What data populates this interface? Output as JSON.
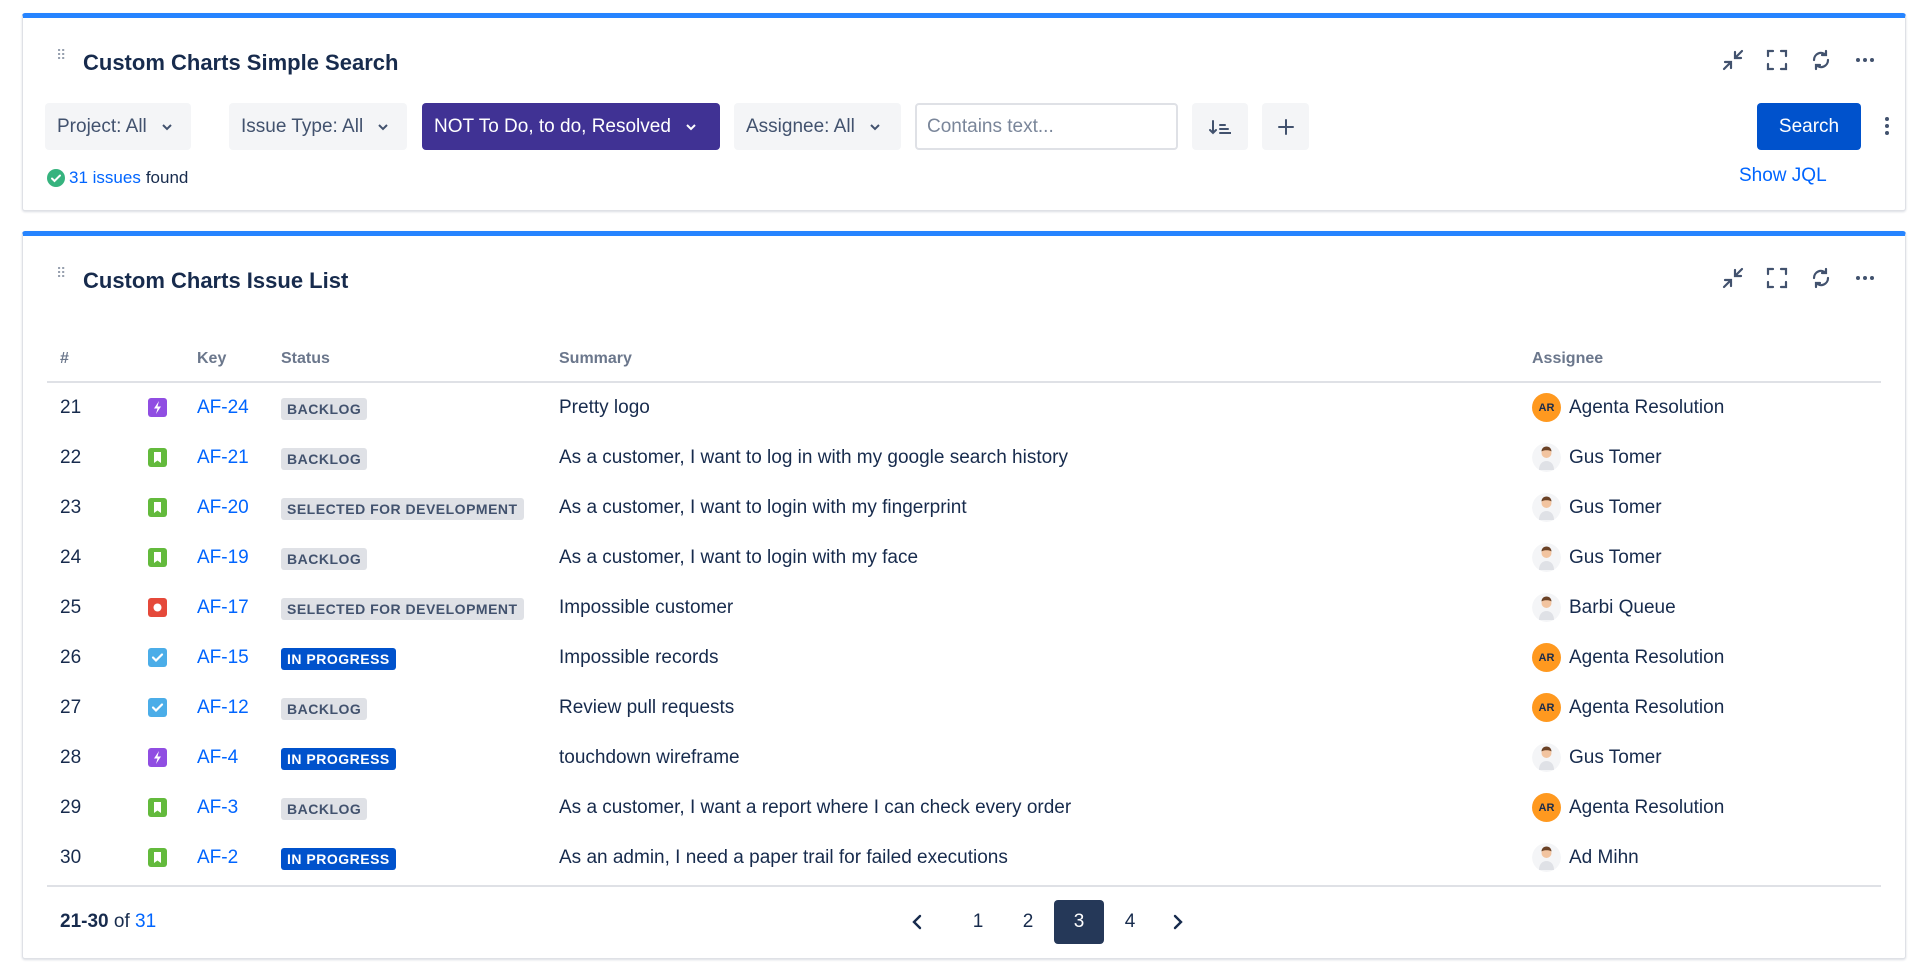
{
  "search_gadget": {
    "title": "Custom Charts Simple Search",
    "filters": {
      "project": "Project: All",
      "issue_type": "Issue Type: All",
      "status": "NOT To Do, to do, Resolved",
      "assignee": "Assignee: All"
    },
    "text_placeholder": "Contains text...",
    "search_label": "Search",
    "result_count": "31 issues",
    "result_suffix": "found",
    "show_jql": "Show JQL"
  },
  "list_gadget": {
    "title": "Custom Charts Issue List",
    "columns": {
      "num": "#",
      "key": "Key",
      "status": "Status",
      "summary": "Summary",
      "assignee": "Assignee"
    },
    "rows": [
      {
        "num": "21",
        "type": "epic-icon",
        "key": "AF-24",
        "status": "BACKLOG",
        "summary": "Pretty logo",
        "assignee": "Agenta Resolution",
        "avatar": "AR"
      },
      {
        "num": "22",
        "type": "story-icon",
        "key": "AF-21",
        "status": "BACKLOG",
        "summary": "As a customer, I want to log in with my google search history",
        "assignee": "Gus Tomer",
        "avatar": "person-avatar"
      },
      {
        "num": "23",
        "type": "story-icon",
        "key": "AF-20",
        "status": "SELECTED FOR DEVELOPMENT",
        "summary": "As a customer, I want to login with my fingerprint",
        "assignee": "Gus Tomer",
        "avatar": "person-avatar"
      },
      {
        "num": "24",
        "type": "story-icon",
        "key": "AF-19",
        "status": "BACKLOG",
        "summary": "As a customer, I want to login with my face",
        "assignee": "Gus Tomer",
        "avatar": "person-avatar"
      },
      {
        "num": "25",
        "type": "bug-icon",
        "key": "AF-17",
        "status": "SELECTED FOR DEVELOPMENT",
        "summary": "Impossible customer",
        "assignee": "Barbi Queue",
        "avatar": "person-avatar"
      },
      {
        "num": "26",
        "type": "task-icon",
        "key": "AF-15",
        "status": "IN PROGRESS",
        "summary": "Impossible records",
        "assignee": "Agenta Resolution",
        "avatar": "AR"
      },
      {
        "num": "27",
        "type": "task-icon",
        "key": "AF-12",
        "status": "BACKLOG",
        "summary": "Review pull requests",
        "assignee": "Agenta Resolution",
        "avatar": "AR"
      },
      {
        "num": "28",
        "type": "epic-icon",
        "key": "AF-4",
        "status": "IN PROGRESS",
        "summary": "touchdown wireframe",
        "assignee": "Gus Tomer",
        "avatar": "person-avatar"
      },
      {
        "num": "29",
        "type": "story-icon",
        "key": "AF-3",
        "status": "BACKLOG",
        "summary": "As a customer, I want a report where I can check every order",
        "assignee": "Agenta Resolution",
        "avatar": "AR"
      },
      {
        "num": "30",
        "type": "story-icon",
        "key": "AF-2",
        "status": "IN PROGRESS",
        "summary": "As an admin, I need a paper trail for failed executions",
        "assignee": "Ad Mihn",
        "avatar": "person-avatar"
      }
    ],
    "footer": {
      "range": "21-30",
      "of": "of",
      "total": "31",
      "pages": [
        "1",
        "2",
        "3",
        "4"
      ],
      "current_page": "3"
    }
  },
  "colors": {
    "accent": "#2684ff",
    "primary_button": "#0052cc",
    "active_filter": "#403294",
    "link": "#0065ff",
    "in_progress": "#0052cc",
    "default_lozenge": "#dfe1e6",
    "epic": "#904ee2",
    "story": "#63ba3c",
    "bug": "#e5493a",
    "task": "#4bade8",
    "initials_avatar": "#ff991f"
  }
}
